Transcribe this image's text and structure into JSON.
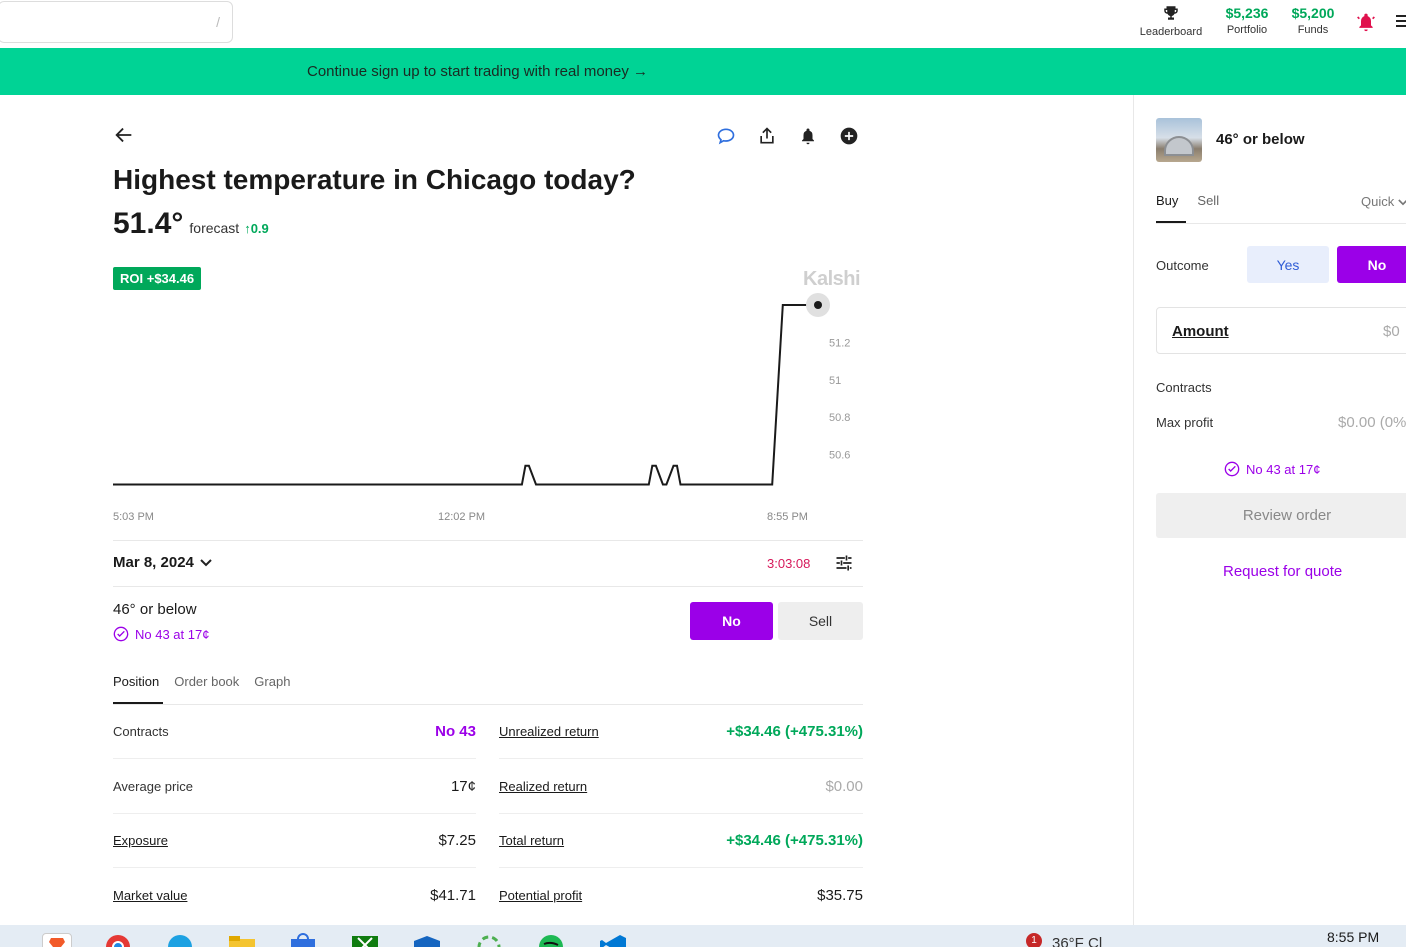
{
  "header": {
    "search_hint": "/",
    "leaderboard_label": "Leaderboard",
    "portfolio_value": "$5,236",
    "portfolio_label": "Portfolio",
    "funds_value": "$5,200",
    "funds_label": "Funds"
  },
  "banner": {
    "text": "Continue sign up to start trading with real money →"
  },
  "market": {
    "title": "Highest temperature in Chicago today?",
    "forecast_value": "51.4°",
    "forecast_label": "forecast",
    "forecast_change": "↑0.9",
    "roi_badge": "ROI +$34.46",
    "watermark": "Kalshi",
    "date": "Mar 8, 2024",
    "timer": "3:03:08",
    "contract_label": "46° or below",
    "position_text": "No 43 at 17¢",
    "no_button": "No",
    "sell_button": "Sell"
  },
  "chart_data": {
    "type": "line",
    "x_tick_labels": [
      "5:03 PM",
      "12:02 PM",
      "8:55 PM"
    ],
    "y_tick_labels": [
      "51.2",
      "51",
      "50.8",
      "50.6"
    ],
    "ylim": [
      50.4,
      51.4
    ],
    "series": [
      {
        "x": [
          0,
          0.58,
          0.585,
          0.59,
          0.6,
          0.605,
          0.76,
          0.765,
          0.77,
          0.78,
          0.785,
          0.795,
          0.8,
          0.805,
          0.81,
          0.815,
          0.935,
          0.95,
          1.0
        ],
        "y": [
          50.44,
          50.44,
          50.54,
          50.54,
          50.44,
          50.44,
          50.44,
          50.54,
          50.54,
          50.44,
          50.44,
          50.54,
          50.54,
          50.44,
          50.44,
          50.44,
          50.44,
          51.4,
          51.4
        ],
        "end_value": 51.4
      }
    ],
    "grid": false
  },
  "tabs": [
    "Position",
    "Order book",
    "Graph"
  ],
  "position_left": [
    {
      "label": "Contracts",
      "value": "No 43",
      "underline": false,
      "style": "purple"
    },
    {
      "label": "Average price",
      "value": "17¢",
      "underline": false,
      "style": ""
    },
    {
      "label": "Exposure",
      "value": "$7.25",
      "underline": true,
      "style": ""
    },
    {
      "label": "Market value",
      "value": "$41.71",
      "underline": true,
      "style": ""
    }
  ],
  "position_right": [
    {
      "label": "Unrealized return",
      "value": "+$34.46 (+475.31%)",
      "underline": true,
      "style": "green"
    },
    {
      "label": "Realized return",
      "value": "$0.00",
      "underline": true,
      "style": "gray"
    },
    {
      "label": "Total return",
      "value": "+$34.46 (+475.31%)",
      "underline": true,
      "style": "green"
    },
    {
      "label": "Potential profit",
      "value": "$35.75",
      "underline": true,
      "style": ""
    }
  ],
  "order_panel": {
    "title": "46° or below",
    "tab_buy": "Buy",
    "tab_sell": "Sell",
    "mode": "Quick",
    "outcome_label": "Outcome",
    "yes_button": "Yes",
    "no_button": "No",
    "amount_label": "Amount",
    "amount_value": "$0",
    "contracts_label": "Contracts",
    "max_profit_label": "Max profit",
    "max_profit_value": "$0.00 (0%",
    "position_text": "No 43 at 17¢",
    "review_button": "Review order",
    "rfq_link": "Request for quote"
  },
  "taskbar": {
    "weather": "36°F  Cl",
    "badge": "1",
    "clock": "8:55 PM"
  },
  "colors": {
    "accent_green": "#00a85a",
    "banner_green": "#00d395",
    "purple": "#9b00e8",
    "timer_red": "#d6185a"
  }
}
